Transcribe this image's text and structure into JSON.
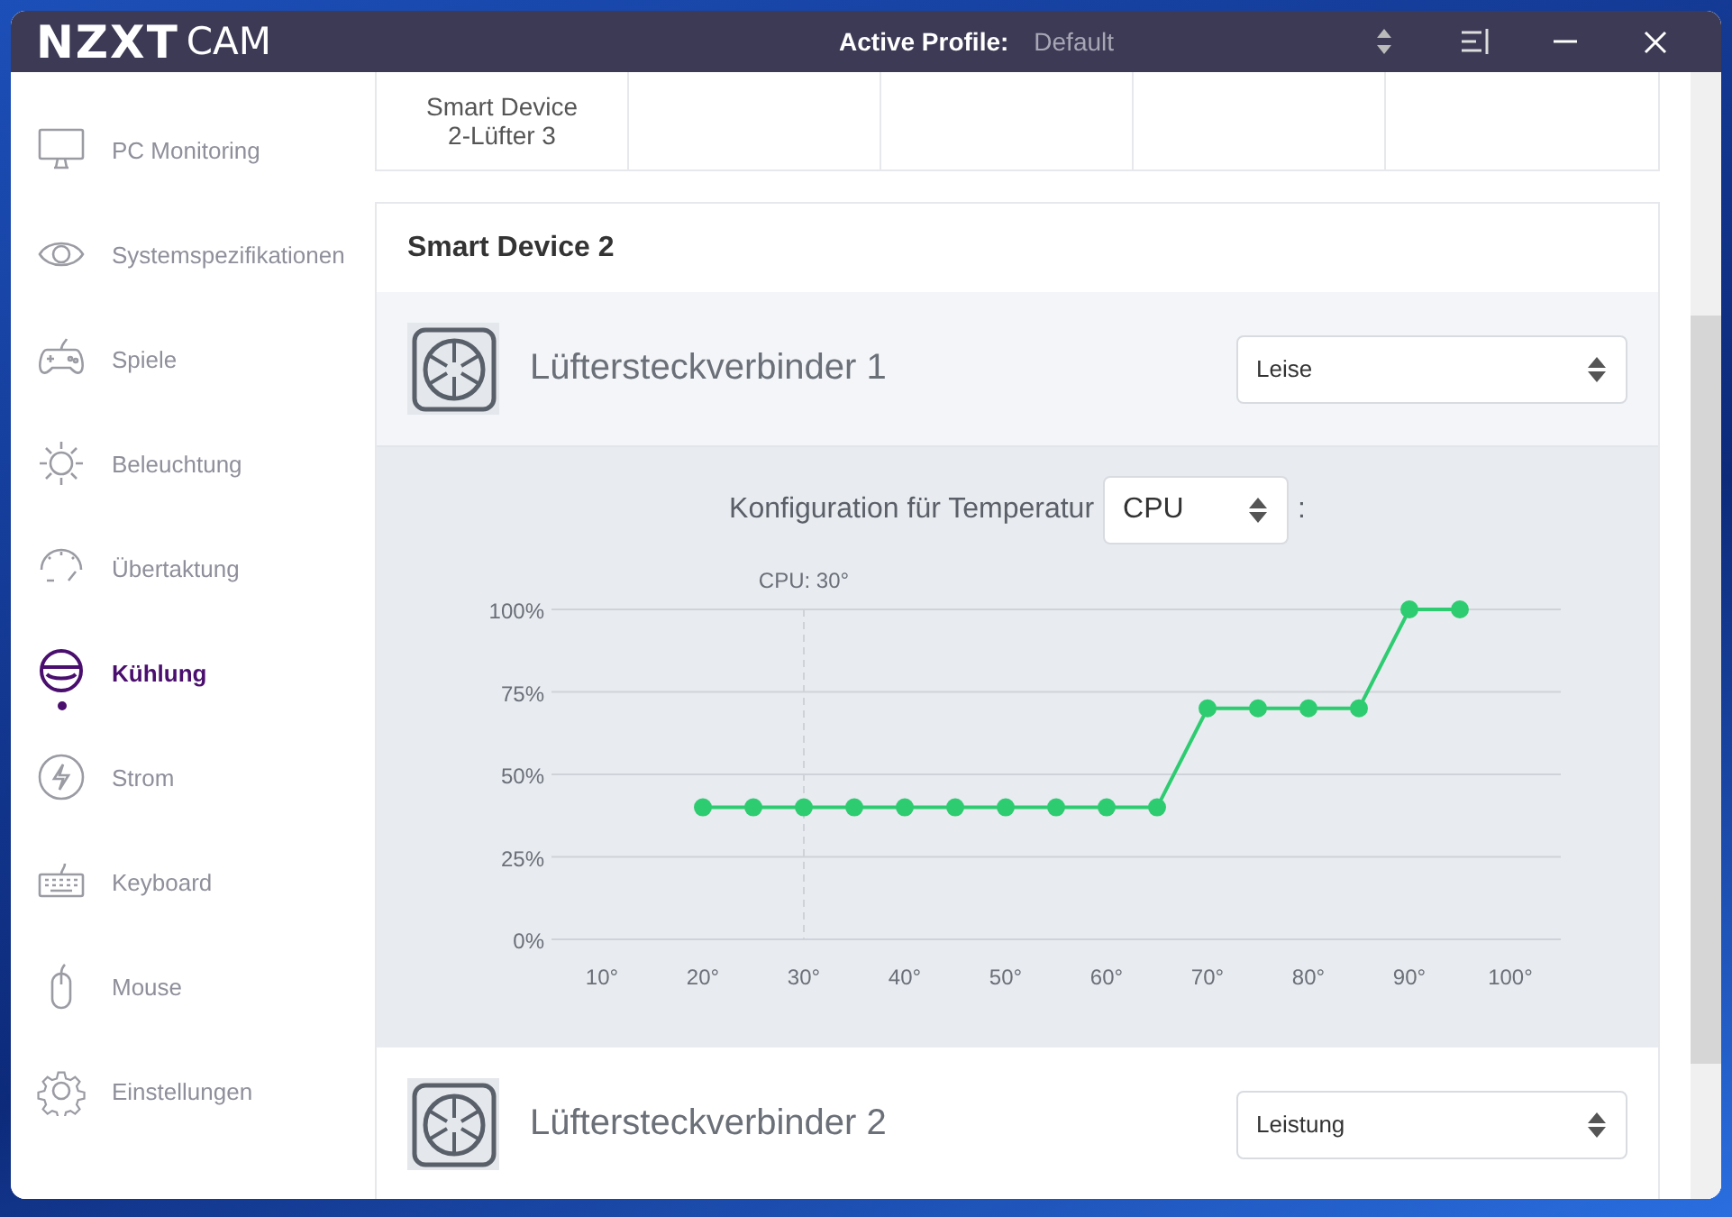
{
  "window": {
    "logo": "NZXT",
    "logo_suffix": "CAM",
    "profile_label": "Active Profile:",
    "profile_value": "Default"
  },
  "sidebar": {
    "items": [
      {
        "label": "PC Monitoring",
        "selected": false
      },
      {
        "label": "Systemspezifikationen",
        "selected": false
      },
      {
        "label": "Spiele",
        "selected": false
      },
      {
        "label": "Beleuchtung",
        "selected": false
      },
      {
        "label": "Übertaktung",
        "selected": false
      },
      {
        "label": "Kühlung",
        "selected": true
      },
      {
        "label": "Strom",
        "selected": false
      },
      {
        "label": "Keyboard",
        "selected": false
      },
      {
        "label": "Mouse",
        "selected": false
      },
      {
        "label": "Einstellungen",
        "selected": false
      }
    ]
  },
  "device_tabs": [
    {
      "label": "Smart Device 2-Lüfter 3"
    }
  ],
  "device": {
    "title": "Smart Device 2",
    "fans": [
      {
        "name": "Lüftersteckverbinder 1",
        "mode": "Leise",
        "expanded": true,
        "config": {
          "label": "Konfiguration für Temperatur",
          "sensor": "CPU",
          "suffix": ":",
          "chart_data": {
            "type": "line",
            "x": [
              20,
              25,
              30,
              35,
              40,
              45,
              50,
              55,
              60,
              65,
              70,
              75,
              80,
              85,
              90,
              95
            ],
            "grid": true,
            "series": [
              {
                "color": "#2ecc71",
                "marker": "circle",
                "values": [
                  40,
                  40,
                  40,
                  40,
                  40,
                  40,
                  40,
                  40,
                  40,
                  40,
                  70,
                  70,
                  70,
                  70,
                  100,
                  100
                ]
              }
            ],
            "xlim": [
              5,
              105
            ],
            "ylim": [
              0,
              100
            ],
            "xticks": [
              {
                "value": 10,
                "label": "10°"
              },
              {
                "value": 20,
                "label": "20°"
              },
              {
                "value": 30,
                "label": "30°"
              },
              {
                "value": 40,
                "label": "40°"
              },
              {
                "value": 50,
                "label": "50°"
              },
              {
                "value": 60,
                "label": "60°"
              },
              {
                "value": 70,
                "label": "70°"
              },
              {
                "value": 80,
                "label": "80°"
              },
              {
                "value": 90,
                "label": "90°"
              },
              {
                "value": 100,
                "label": "100°"
              }
            ],
            "yticks": [
              {
                "value": 0,
                "label": "0%"
              },
              {
                "value": 25,
                "label": "25%"
              },
              {
                "value": 50,
                "label": "50%"
              },
              {
                "value": 75,
                "label": "75%"
              },
              {
                "value": 100,
                "label": "100%"
              }
            ],
            "annotations": [
              {
                "x": 30,
                "text": "CPU: 30°"
              }
            ]
          }
        }
      },
      {
        "name": "Lüftersteckverbinder 2",
        "mode": "Leistung",
        "expanded": false
      }
    ]
  }
}
